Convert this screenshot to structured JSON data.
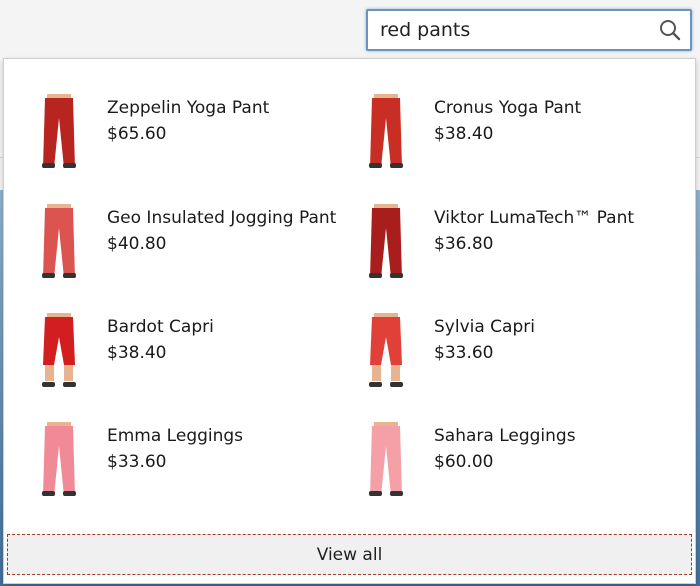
{
  "search": {
    "value": "red pants",
    "icon": "search-icon"
  },
  "results": [
    {
      "name": "Zeppelin Yoga Pant",
      "price": "$65.60",
      "color": "#b8241f",
      "style": "long"
    },
    {
      "name": "Cronus Yoga Pant",
      "price": "$38.40",
      "color": "#c82e24",
      "style": "long"
    },
    {
      "name": "Geo Insulated Jogging Pant",
      "price": "$40.80",
      "color": "#dc5450",
      "style": "long"
    },
    {
      "name": "Viktor LumaTech™ Pant",
      "price": "$36.80",
      "color": "#a81e1c",
      "style": "long"
    },
    {
      "name": "Bardot Capri",
      "price": "$38.40",
      "color": "#d21e1e",
      "style": "capri"
    },
    {
      "name": "Sylvia Capri",
      "price": "$33.60",
      "color": "#e04038",
      "style": "capri"
    },
    {
      "name": "Emma Leggings",
      "price": "$33.60",
      "color": "#f08a96",
      "style": "leggings"
    },
    {
      "name": "Sahara Leggings",
      "price": "$60.00",
      "color": "#f4a0a6",
      "style": "leggings"
    }
  ],
  "view_all_label": "View all"
}
